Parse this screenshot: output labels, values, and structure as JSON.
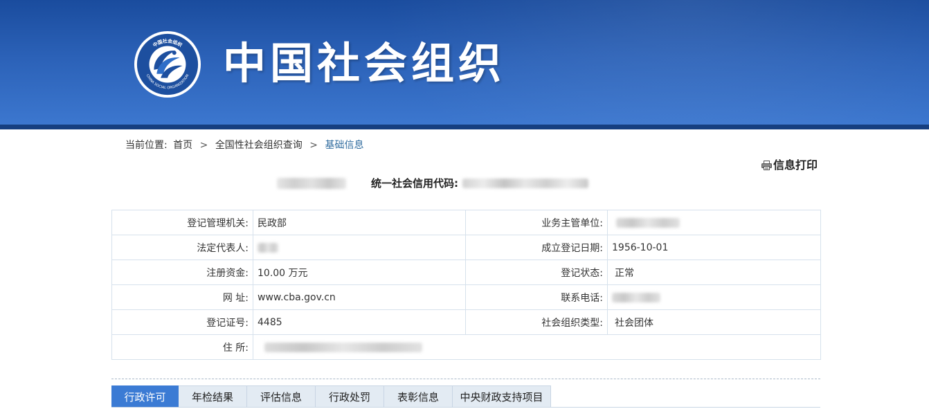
{
  "header": {
    "title": "中国社会组织",
    "emblem_text": "中国社会组织",
    "emblem_text_en": "CHINA SOCIAL ORGANIZATION"
  },
  "breadcrumb": {
    "prefix": "当前位置:",
    "items": [
      "首页",
      "全国性社会组织查询",
      "基础信息"
    ],
    "separator": ">"
  },
  "print": {
    "label": "信息打印",
    "icon": "printer-icon"
  },
  "org": {
    "code_label": "统一社会信用代码:"
  },
  "info": {
    "rows": [
      {
        "left_label": "登记管理机关:",
        "left_value": "民政部",
        "right_label": "业务主管单位:",
        "right_value": ""
      },
      {
        "left_label": "法定代表人:",
        "left_value": "",
        "right_label": "成立登记日期:",
        "right_value": "1956-10-01"
      },
      {
        "left_label": "注册资金:",
        "left_value": "10.00 万元",
        "right_label": "登记状态:",
        "right_value": "正常"
      },
      {
        "left_label": "网 址:",
        "left_value": "www.cba.gov.cn",
        "right_label": "联系电话:",
        "right_value": ""
      },
      {
        "left_label": "登记证号:",
        "left_value": "4485",
        "right_label": "社会组织类型:",
        "right_value": "社会团体"
      },
      {
        "left_label": "住 所:",
        "left_value": ""
      }
    ]
  },
  "tabs": [
    "行政许可",
    "年检结果",
    "评估信息",
    "行政处罚",
    "表彰信息",
    "中央财政支持项目"
  ],
  "colors": {
    "banner": "#2b61b7",
    "active_tab": "#3b7bd4",
    "link": "#2f6b9e"
  }
}
